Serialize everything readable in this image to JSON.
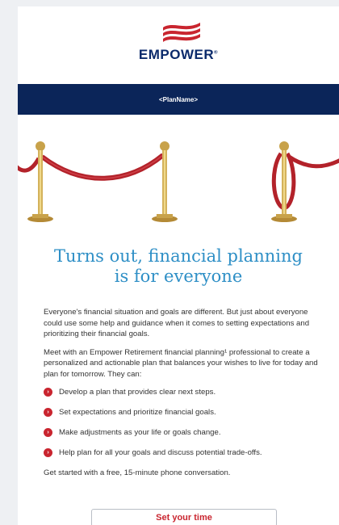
{
  "brand": {
    "logo_text": "EMPOWER",
    "trademark": "®",
    "navy": "#0b2559",
    "accent_red": "#c9252f",
    "headline_blue": "#2e8fc6"
  },
  "plan_bar": {
    "label": "<PlanName>"
  },
  "hero": {
    "image": "red-rope-stanchions"
  },
  "headline": {
    "line1": "Turns out, financial planning",
    "line2": "is for everyone"
  },
  "body": {
    "paragraph1": "Everyone's financial situation and goals are different. But just about everyone could use some help and guidance when it comes to setting expectations and prioritizing their financial goals.",
    "paragraph2": "Meet with an Empower Retirement financial planning¹ professional to create a personalized and actionable plan that balances your wishes to live for today and plan for tomorrow. They can:",
    "bullets": [
      "Develop a plan that provides clear next steps.",
      "Set expectations and prioritize financial goals.",
      "Make adjustments as your life or goals change.",
      "Help plan for all your goals and discuss potential trade-offs."
    ],
    "closing": "Get started with a free, 15-minute phone conversation."
  },
  "cta": {
    "label": "Set your time"
  },
  "icons": {
    "bullet": "chevron-right-circle-icon"
  }
}
